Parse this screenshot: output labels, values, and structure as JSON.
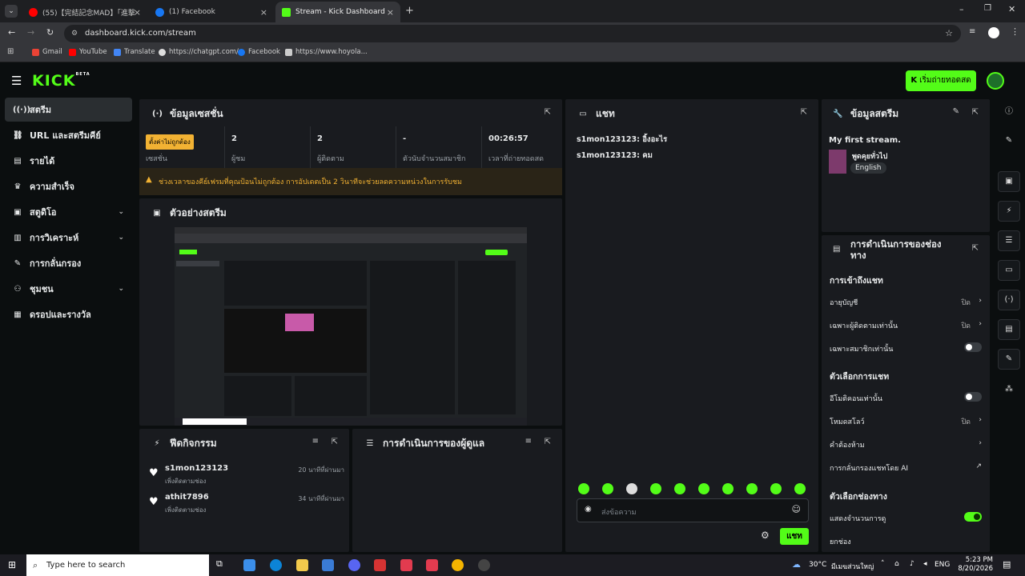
{
  "browser": {
    "tabs": [
      {
        "title": "(55)【完結記念MAD】「進撃",
        "color": "#ff0000"
      },
      {
        "title": "(1) Facebook",
        "color": "#1877f2"
      },
      {
        "title": "Stream - Kick Dashboard",
        "color": "#53fc18"
      }
    ],
    "url": "dashboard.kick.com/stream",
    "bookmarks": [
      {
        "label": "Gmail",
        "color": "#ea4335"
      },
      {
        "label": "YouTube",
        "color": "#ff0000"
      },
      {
        "label": "Translate",
        "color": "#4285f4"
      },
      {
        "label": "https://chatgpt.com/",
        "color": "#dddddd"
      },
      {
        "label": "Facebook",
        "color": "#1877f2"
      },
      {
        "label": "https://www.hoyola...",
        "color": "#cccccc"
      }
    ]
  },
  "header": {
    "logo": "KICK",
    "logo_badge": "BETA",
    "go_live": "เริ่มถ่ายทอดสด"
  },
  "sidebar": {
    "items": [
      {
        "label": "สตรีม",
        "icon": "broadcast-icon",
        "glyph": "((·))"
      },
      {
        "label": "URL และสตรีมคีย์",
        "icon": "link-icon",
        "glyph": "⛓"
      },
      {
        "label": "รายได้",
        "icon": "revenue-icon",
        "glyph": "▤"
      },
      {
        "label": "ความสำเร็จ",
        "icon": "trophy-icon",
        "glyph": "🏆"
      },
      {
        "label": "สตูดิโอ",
        "icon": "studio-icon",
        "glyph": "▣"
      },
      {
        "label": "การวิเคราะห์",
        "icon": "analytics-icon",
        "glyph": "▥"
      },
      {
        "label": "การกลั่นกรอง",
        "icon": "wrench-icon",
        "glyph": "🔧"
      },
      {
        "label": "ชุมชน",
        "icon": "community-icon",
        "glyph": "👥"
      },
      {
        "label": "ดรอปและรางวัล",
        "icon": "drops-icon",
        "glyph": "▦"
      }
    ]
  },
  "session": {
    "title": "ข้อมูลเซสชั่น",
    "badge": "ตั้งค่าไม่ถูกต้อง",
    "session_label": "เซสชั่น",
    "stats": [
      {
        "value": "2",
        "label": "ผู้ชม"
      },
      {
        "value": "2",
        "label": "ผู้ติดตาม"
      },
      {
        "value": "-",
        "label": "ตัวนับจำนวนสมาชิก"
      },
      {
        "value": "00:26:57",
        "label": "เวลาที่ถ่ายทอดสด"
      }
    ],
    "warning": "ช่วงเวลาของคีย์เฟรมที่คุณป้อนไม่ถูกต้อง การอัปเดตเป็น 2 วินาทีจะช่วยลดความหน่วงในการรับชม"
  },
  "preview": {
    "title": "ตัวอย่างสตรีม"
  },
  "activity": {
    "title": "ฟีดกิจกรรม",
    "rows": [
      {
        "name": "s1mon123123",
        "sub": "เพิ่งติดตามช่อง",
        "time": "20 นาทีที่ผ่านมา"
      },
      {
        "name": "athit7896",
        "sub": "เพิ่งติดตามช่อง",
        "time": "34 นาทีที่ผ่านมา"
      }
    ]
  },
  "modactions": {
    "title": "การดำเนินการของผู้ดูแล"
  },
  "chat": {
    "title": "แชท",
    "messages": [
      {
        "text": "s1mon123123: อิ้งอะไร"
      },
      {
        "text": "s1mon123123: คม"
      }
    ],
    "placeholder": "ส่งข้อความ",
    "send": "แชท"
  },
  "streaminfo": {
    "title": "ข้อมูลสตรีม",
    "stream_title": "My first stream.",
    "category": "พูดคุยทั่วไป",
    "language": "English"
  },
  "channelactions": {
    "title_line1": "การดำเนินการของช่อง",
    "title_line2": "ทาง",
    "chat_access": "การเข้าถึงแชท",
    "account_age": "อายุบัญชี",
    "account_age_val": "ปิด",
    "followers_only": "เฉพาะผู้ติดตามเท่านั้น",
    "followers_only_val": "ปิด",
    "subs_only": "เฉพาะสมาชิกเท่านั้น",
    "chat_options": "ตัวเลือกการแชท",
    "emotes_only": "อีโมติคอนเท่านั้น",
    "slow_mode": "โหมดสโลว์",
    "slow_mode_val": "ปิด",
    "banned_words": "คำต้องห้าม",
    "ai_moderation": "การกลั่นกรองแชทโดย AI",
    "channel_options": "ตัวเลือกช่องทาง",
    "show_viewers": "แสดงจำนวนการดู",
    "leave_channel": "ยกช่อง"
  },
  "taskbar": {
    "search": "Type here to search",
    "weather": "30°C",
    "weather_text": "มีเมฆส่วนใหญ่",
    "lang": "ENG",
    "time": "5:23 PM",
    "date": "8/20/2026"
  }
}
